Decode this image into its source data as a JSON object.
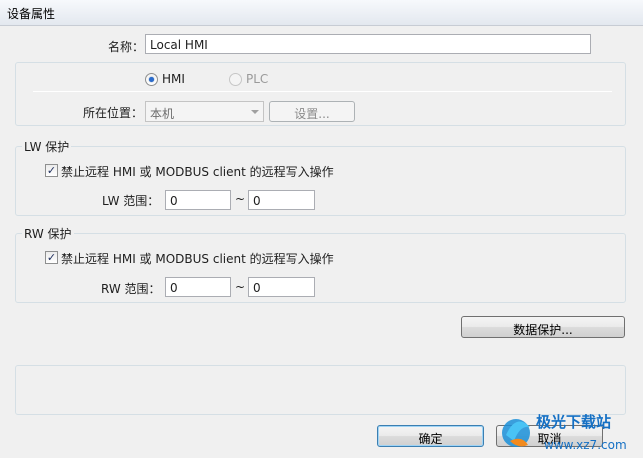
{
  "window": {
    "title": "设备属性"
  },
  "name_field": {
    "label": "名称：",
    "value": "Local HMI"
  },
  "device_type": {
    "options": [
      {
        "label": "HMI",
        "selected": true,
        "enabled": true
      },
      {
        "label": "PLC",
        "selected": false,
        "enabled": false
      }
    ]
  },
  "location": {
    "label": "所在位置：",
    "value": "本机",
    "settings_button": "设置..."
  },
  "lw_protect": {
    "title": "LW 保护",
    "checkbox_label": "禁止远程 HMI 或 MODBUS client 的远程写入操作",
    "checked": true,
    "range_label": "LW 范围：",
    "from": "0",
    "separator": "~",
    "to": "0"
  },
  "rw_protect": {
    "title": "RW 保护",
    "checkbox_label": "禁止远程 HMI 或 MODBUS client 的远程写入操作",
    "checked": true,
    "range_label": "RW 范围：",
    "from": "0",
    "separator": "~",
    "to": "0"
  },
  "data_protect_button": "数据保护...",
  "footer": {
    "ok": "确定",
    "cancel": "取消"
  },
  "watermark": {
    "cn": "极光下载站",
    "url": "www.xz7.com"
  },
  "colors": {
    "accent": "#2a6bcc",
    "border": "#d5dfe5",
    "background": "#f0f0f0"
  }
}
